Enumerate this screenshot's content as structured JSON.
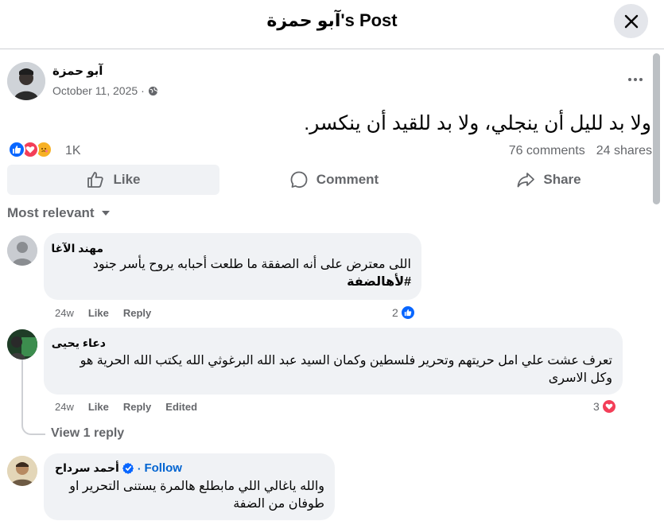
{
  "header": {
    "title": "آبو حمزة's Post",
    "close_icon": "close-icon"
  },
  "post": {
    "author": "آبو حمزة",
    "date": "October 11, 2025",
    "date_icon": "globe-icon",
    "text": "ولا بد لليل أن ينجلي، ولا بد للقيد أن ينكسر.",
    "reactions": [
      "like-icon",
      "love-icon",
      "care-icon"
    ],
    "reaction_count": "1K",
    "comments_count": "76 comments",
    "shares_count": "24 shares"
  },
  "actions": {
    "like": "Like",
    "comment": "Comment",
    "share": "Share"
  },
  "sort_label": "Most relevant",
  "comments": [
    {
      "name": "مهند الآغا",
      "text": "اللى معترض على أنه الصفقة ما طلعت أحبابه يروح يأسر جنود",
      "hashtag": "#لأهالضفة",
      "time": "24w",
      "like": "Like",
      "reply": "Reply",
      "reaction_count": "2"
    },
    {
      "name": "دعاء يحيى",
      "text": "تعرف عشت علي امل حريتهم وتحرير فلسطين وكمان السيد عبد الله البرغوثي الله يكتب الله الحرية هو وكل الاسرى",
      "time": "24w",
      "like": "Like",
      "reply": "Reply",
      "edited": "Edited",
      "reaction_count": "3",
      "view_replies": "View 1 reply"
    },
    {
      "name": "أحمد سرداح",
      "follow": "Follow",
      "separator": "·",
      "text": "والله ياغالي اللي مابطلع هالمرة يستنى التحرير او طوفان من الضفة"
    }
  ],
  "colors": {
    "accent": "#0866ff",
    "love": "#f33e58",
    "muted": "#65676b",
    "bubble": "#f0f2f5"
  }
}
